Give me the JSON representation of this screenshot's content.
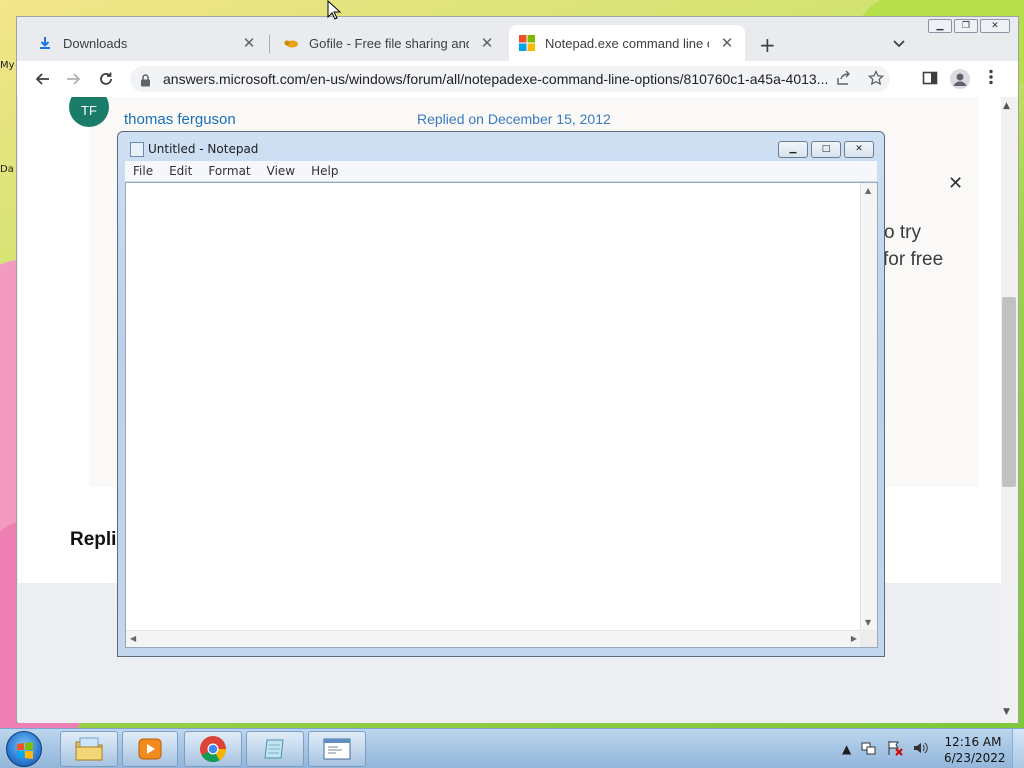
{
  "desktop": {
    "labels": [
      "My",
      "Da"
    ]
  },
  "browser": {
    "tabs": [
      {
        "title": "Downloads",
        "icon": "download-icon",
        "active": false
      },
      {
        "title": "Gofile - Free file sharing and storage",
        "icon": "gofile-squirrel-icon",
        "active": false
      },
      {
        "title": "Notepad.exe command line options",
        "icon": "microsoft-logo-icon",
        "active": true
      }
    ],
    "new_tab_label": "+",
    "address_bar": {
      "url": "answers.microsoft.com/en-us/windows/forum/all/notepadexe-command-line-options/810760c1-a45a-4013..."
    },
    "page": {
      "avatar_initials": "TF",
      "user_name": "thomas ferguson",
      "reply_date": "Replied on December 15, 2012",
      "partial_text_1": "o try",
      "partial_text_2": "for free",
      "section_heading": "Replie"
    }
  },
  "notepad": {
    "title": "Untitled - Notepad",
    "menu": [
      "File",
      "Edit",
      "Format",
      "View",
      "Help"
    ],
    "content": ""
  },
  "taskbar": {
    "apps": [
      "windows-explorer",
      "media-player",
      "chrome",
      "notepad-app",
      "notepad-window"
    ],
    "clock": {
      "time": "12:16 AM",
      "date": "6/23/2022"
    }
  },
  "colors": {
    "accent_link": "#1a6fb5",
    "avatar_bg": "#1b7d69"
  }
}
